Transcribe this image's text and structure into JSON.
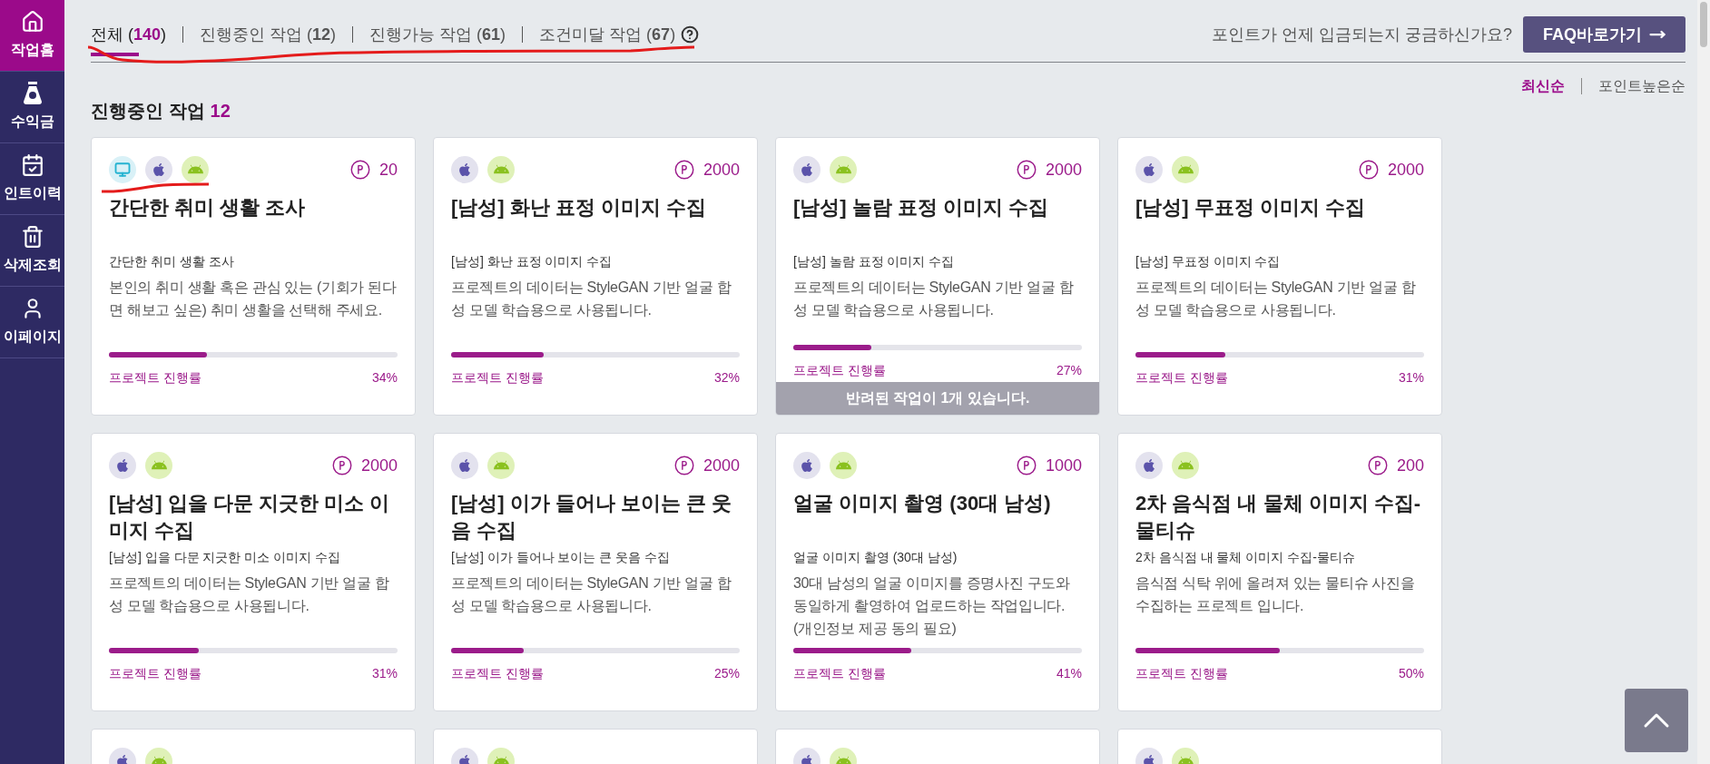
{
  "sidebar": {
    "items": [
      {
        "kind": "home",
        "label": "작업홈",
        "selected": true
      },
      {
        "kind": "money",
        "label": "수익금",
        "selected": false
      },
      {
        "kind": "history",
        "label": "인트이력",
        "selected": false
      },
      {
        "kind": "trash",
        "label": "삭제조회",
        "selected": false
      },
      {
        "kind": "user",
        "label": "이페이지",
        "selected": false
      }
    ]
  },
  "tabs": [
    {
      "label": "전체 (",
      "count": "140",
      "close": ")",
      "selected": true,
      "help": false
    },
    {
      "label": "진행중인 작업 (",
      "count": "12",
      "close": ")",
      "selected": false,
      "help": false
    },
    {
      "label": "진행가능 작업 (",
      "count": "61",
      "close": ")",
      "selected": false,
      "help": false
    },
    {
      "label": "조건미달 작업 (",
      "count": "67",
      "close": ")",
      "selected": false,
      "help": true
    }
  ],
  "faq": {
    "question": "포인트가 언제 입금되는지 궁금하신가요?",
    "button": "FAQ바로가기"
  },
  "sort": [
    {
      "label": "최신순",
      "selected": true
    },
    {
      "label": "포인트높은순",
      "selected": false
    }
  ],
  "section": {
    "title": "진행중인 작업",
    "count": "12"
  },
  "cards": [
    {
      "platforms": [
        {
          "kind": "desktop"
        },
        {
          "kind": "ios"
        },
        {
          "kind": "android"
        }
      ],
      "points": "20",
      "title": "간단한 취미 생활 조사",
      "subtitle": "간단한 취미 생활 조사",
      "description": "본인의 취미 생활 혹은 관심 있는 (기회가 된다면 해보고 싶은) 취미 생활을 선택해 주세요.",
      "level": 0.34,
      "progress_label": "프로젝트 진행률",
      "percent": "34%"
    },
    {
      "platforms": [
        {
          "kind": "ios"
        },
        {
          "kind": "android"
        }
      ],
      "points": "2000",
      "title": "[남성] 화난 표정 이미지 수집",
      "subtitle": "[남성] 화난 표정 이미지 수집",
      "description": "프로젝트의 데이터는  StyleGAN 기반 얼굴 합성 모델 학습용으로 사용됩니다.",
      "level": 0.32,
      "progress_label": "프로젝트 진행률",
      "percent": "32%"
    },
    {
      "platforms": [
        {
          "kind": "ios"
        },
        {
          "kind": "android"
        }
      ],
      "points": "2000",
      "title": "[남성] 놀람 표정 이미지 수집",
      "subtitle": "[남성] 놀람 표정 이미지 수집",
      "description": "프로젝트의 데이터는  StyleGAN 기반 얼굴 합성 모델 학습용으로 사용됩니다.",
      "level": 0.27,
      "progress_label": "프로젝트 진행률",
      "percent": "27%",
      "notice": "반려된 작업이 1개 있습니다."
    },
    {
      "platforms": [
        {
          "kind": "ios"
        },
        {
          "kind": "android"
        }
      ],
      "points": "2000",
      "title": "[남성] 무표정 이미지 수집",
      "subtitle": "[남성] 무표정 이미지 수집",
      "description": "프로젝트의 데이터는  StyleGAN 기반 얼굴 합성 모델 학습용으로 사용됩니다.",
      "level": 0.31,
      "progress_label": "프로젝트 진행률",
      "percent": "31%"
    },
    {
      "platforms": [
        {
          "kind": "ios"
        },
        {
          "kind": "android"
        }
      ],
      "points": "2000",
      "title": "[남성] 입을 다문 지긋한 미소 이미지 수집",
      "subtitle": "[남성] 입을 다문 지긋한 미소 이미지 수집",
      "description": "프로젝트의 데이터는  StyleGAN 기반 얼굴 합성 모델 학습용으로 사용됩니다.",
      "level": 0.31,
      "progress_label": "프로젝트 진행률",
      "percent": "31%"
    },
    {
      "platforms": [
        {
          "kind": "ios"
        },
        {
          "kind": "android"
        }
      ],
      "points": "2000",
      "title": "[남성] 이가 들어나 보이는 큰 웃음 수집",
      "subtitle": "[남성] 이가 들어나 보이는 큰 웃음 수집",
      "description": "프로젝트의 데이터는  StyleGAN 기반 얼굴 합성 모델 학습용으로 사용됩니다.",
      "level": 0.25,
      "progress_label": "프로젝트 진행률",
      "percent": "25%"
    },
    {
      "platforms": [
        {
          "kind": "ios"
        },
        {
          "kind": "android"
        }
      ],
      "points": "1000",
      "title": "얼굴 이미지 촬영 (30대 남성)",
      "subtitle": "얼굴 이미지 촬영 (30대 남성)",
      "description": "30대 남성의 얼굴 이미지를 증명사진 구도와 동일하게 촬영하여 업로드하는 작업입니다. (개인정보 제공 동의 필요)",
      "level": 0.41,
      "progress_label": "프로젝트 진행률",
      "percent": "41%"
    },
    {
      "platforms": [
        {
          "kind": "ios"
        },
        {
          "kind": "android"
        }
      ],
      "points": "200",
      "title": "2차 음식점 내 물체 이미지 수집-물티슈",
      "subtitle": "2차 음식점 내 물체 이미지 수집-물티슈",
      "description": "음식점 식탁 위에 올려져 있는 물티슈 사진을 수집하는 프로젝트 입니다.",
      "level": 0.5,
      "progress_label": "프로젝트 진행률",
      "percent": "50%"
    },
    {
      "platforms": [
        {
          "kind": "ios"
        },
        {
          "kind": "android"
        }
      ]
    },
    {
      "platforms": [
        {
          "kind": "ios"
        },
        {
          "kind": "android"
        }
      ]
    },
    {
      "platforms": [
        {
          "kind": "ios"
        },
        {
          "kind": "android"
        }
      ]
    },
    {
      "platforms": [
        {
          "kind": "ios"
        },
        {
          "kind": "android"
        }
      ]
    }
  ]
}
